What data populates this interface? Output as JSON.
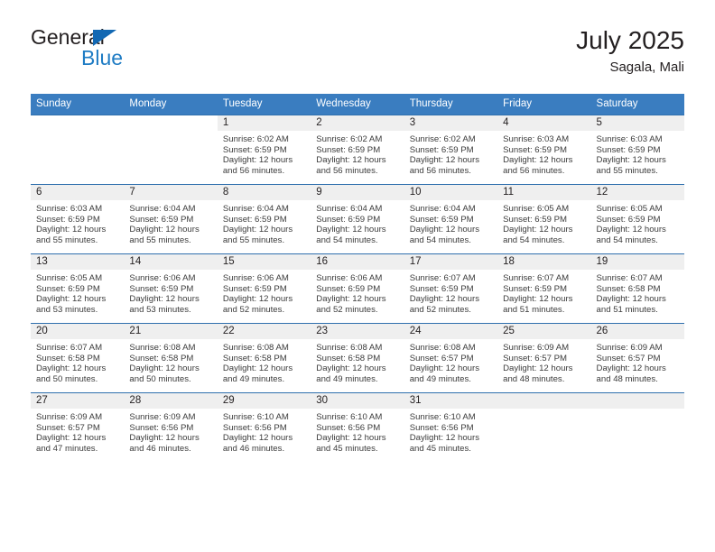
{
  "brand": {
    "name_top": "General",
    "name_bottom": "Blue",
    "accent_color": "#1f7cc4",
    "triangle_color": "#1268b3"
  },
  "header": {
    "title": "July 2025",
    "subtitle": "Sagala, Mali",
    "header_bg": "#3a7dc0",
    "band_bg": "#efefef",
    "rule_color": "#2f6fad"
  },
  "weekdays": [
    "Sunday",
    "Monday",
    "Tuesday",
    "Wednesday",
    "Thursday",
    "Friday",
    "Saturday"
  ],
  "weeks": [
    [
      {
        "day": "",
        "blank": true,
        "sunrise": "",
        "sunset": "",
        "daylight1": "",
        "daylight2": ""
      },
      {
        "day": "",
        "blank": true,
        "sunrise": "",
        "sunset": "",
        "daylight1": "",
        "daylight2": ""
      },
      {
        "day": "1",
        "blank": false,
        "sunrise": "Sunrise: 6:02 AM",
        "sunset": "Sunset: 6:59 PM",
        "daylight1": "Daylight: 12 hours",
        "daylight2": "and 56 minutes."
      },
      {
        "day": "2",
        "blank": false,
        "sunrise": "Sunrise: 6:02 AM",
        "sunset": "Sunset: 6:59 PM",
        "daylight1": "Daylight: 12 hours",
        "daylight2": "and 56 minutes."
      },
      {
        "day": "3",
        "blank": false,
        "sunrise": "Sunrise: 6:02 AM",
        "sunset": "Sunset: 6:59 PM",
        "daylight1": "Daylight: 12 hours",
        "daylight2": "and 56 minutes."
      },
      {
        "day": "4",
        "blank": false,
        "sunrise": "Sunrise: 6:03 AM",
        "sunset": "Sunset: 6:59 PM",
        "daylight1": "Daylight: 12 hours",
        "daylight2": "and 56 minutes."
      },
      {
        "day": "5",
        "blank": false,
        "sunrise": "Sunrise: 6:03 AM",
        "sunset": "Sunset: 6:59 PM",
        "daylight1": "Daylight: 12 hours",
        "daylight2": "and 55 minutes."
      }
    ],
    [
      {
        "day": "6",
        "blank": false,
        "sunrise": "Sunrise: 6:03 AM",
        "sunset": "Sunset: 6:59 PM",
        "daylight1": "Daylight: 12 hours",
        "daylight2": "and 55 minutes."
      },
      {
        "day": "7",
        "blank": false,
        "sunrise": "Sunrise: 6:04 AM",
        "sunset": "Sunset: 6:59 PM",
        "daylight1": "Daylight: 12 hours",
        "daylight2": "and 55 minutes."
      },
      {
        "day": "8",
        "blank": false,
        "sunrise": "Sunrise: 6:04 AM",
        "sunset": "Sunset: 6:59 PM",
        "daylight1": "Daylight: 12 hours",
        "daylight2": "and 55 minutes."
      },
      {
        "day": "9",
        "blank": false,
        "sunrise": "Sunrise: 6:04 AM",
        "sunset": "Sunset: 6:59 PM",
        "daylight1": "Daylight: 12 hours",
        "daylight2": "and 54 minutes."
      },
      {
        "day": "10",
        "blank": false,
        "sunrise": "Sunrise: 6:04 AM",
        "sunset": "Sunset: 6:59 PM",
        "daylight1": "Daylight: 12 hours",
        "daylight2": "and 54 minutes."
      },
      {
        "day": "11",
        "blank": false,
        "sunrise": "Sunrise: 6:05 AM",
        "sunset": "Sunset: 6:59 PM",
        "daylight1": "Daylight: 12 hours",
        "daylight2": "and 54 minutes."
      },
      {
        "day": "12",
        "blank": false,
        "sunrise": "Sunrise: 6:05 AM",
        "sunset": "Sunset: 6:59 PM",
        "daylight1": "Daylight: 12 hours",
        "daylight2": "and 54 minutes."
      }
    ],
    [
      {
        "day": "13",
        "blank": false,
        "sunrise": "Sunrise: 6:05 AM",
        "sunset": "Sunset: 6:59 PM",
        "daylight1": "Daylight: 12 hours",
        "daylight2": "and 53 minutes."
      },
      {
        "day": "14",
        "blank": false,
        "sunrise": "Sunrise: 6:06 AM",
        "sunset": "Sunset: 6:59 PM",
        "daylight1": "Daylight: 12 hours",
        "daylight2": "and 53 minutes."
      },
      {
        "day": "15",
        "blank": false,
        "sunrise": "Sunrise: 6:06 AM",
        "sunset": "Sunset: 6:59 PM",
        "daylight1": "Daylight: 12 hours",
        "daylight2": "and 52 minutes."
      },
      {
        "day": "16",
        "blank": false,
        "sunrise": "Sunrise: 6:06 AM",
        "sunset": "Sunset: 6:59 PM",
        "daylight1": "Daylight: 12 hours",
        "daylight2": "and 52 minutes."
      },
      {
        "day": "17",
        "blank": false,
        "sunrise": "Sunrise: 6:07 AM",
        "sunset": "Sunset: 6:59 PM",
        "daylight1": "Daylight: 12 hours",
        "daylight2": "and 52 minutes."
      },
      {
        "day": "18",
        "blank": false,
        "sunrise": "Sunrise: 6:07 AM",
        "sunset": "Sunset: 6:59 PM",
        "daylight1": "Daylight: 12 hours",
        "daylight2": "and 51 minutes."
      },
      {
        "day": "19",
        "blank": false,
        "sunrise": "Sunrise: 6:07 AM",
        "sunset": "Sunset: 6:58 PM",
        "daylight1": "Daylight: 12 hours",
        "daylight2": "and 51 minutes."
      }
    ],
    [
      {
        "day": "20",
        "blank": false,
        "sunrise": "Sunrise: 6:07 AM",
        "sunset": "Sunset: 6:58 PM",
        "daylight1": "Daylight: 12 hours",
        "daylight2": "and 50 minutes."
      },
      {
        "day": "21",
        "blank": false,
        "sunrise": "Sunrise: 6:08 AM",
        "sunset": "Sunset: 6:58 PM",
        "daylight1": "Daylight: 12 hours",
        "daylight2": "and 50 minutes."
      },
      {
        "day": "22",
        "blank": false,
        "sunrise": "Sunrise: 6:08 AM",
        "sunset": "Sunset: 6:58 PM",
        "daylight1": "Daylight: 12 hours",
        "daylight2": "and 49 minutes."
      },
      {
        "day": "23",
        "blank": false,
        "sunrise": "Sunrise: 6:08 AM",
        "sunset": "Sunset: 6:58 PM",
        "daylight1": "Daylight: 12 hours",
        "daylight2": "and 49 minutes."
      },
      {
        "day": "24",
        "blank": false,
        "sunrise": "Sunrise: 6:08 AM",
        "sunset": "Sunset: 6:57 PM",
        "daylight1": "Daylight: 12 hours",
        "daylight2": "and 49 minutes."
      },
      {
        "day": "25",
        "blank": false,
        "sunrise": "Sunrise: 6:09 AM",
        "sunset": "Sunset: 6:57 PM",
        "daylight1": "Daylight: 12 hours",
        "daylight2": "and 48 minutes."
      },
      {
        "day": "26",
        "blank": false,
        "sunrise": "Sunrise: 6:09 AM",
        "sunset": "Sunset: 6:57 PM",
        "daylight1": "Daylight: 12 hours",
        "daylight2": "and 48 minutes."
      }
    ],
    [
      {
        "day": "27",
        "blank": false,
        "sunrise": "Sunrise: 6:09 AM",
        "sunset": "Sunset: 6:57 PM",
        "daylight1": "Daylight: 12 hours",
        "daylight2": "and 47 minutes."
      },
      {
        "day": "28",
        "blank": false,
        "sunrise": "Sunrise: 6:09 AM",
        "sunset": "Sunset: 6:56 PM",
        "daylight1": "Daylight: 12 hours",
        "daylight2": "and 46 minutes."
      },
      {
        "day": "29",
        "blank": false,
        "sunrise": "Sunrise: 6:10 AM",
        "sunset": "Sunset: 6:56 PM",
        "daylight1": "Daylight: 12 hours",
        "daylight2": "and 46 minutes."
      },
      {
        "day": "30",
        "blank": false,
        "sunrise": "Sunrise: 6:10 AM",
        "sunset": "Sunset: 6:56 PM",
        "daylight1": "Daylight: 12 hours",
        "daylight2": "and 45 minutes."
      },
      {
        "day": "31",
        "blank": false,
        "sunrise": "Sunrise: 6:10 AM",
        "sunset": "Sunset: 6:56 PM",
        "daylight1": "Daylight: 12 hours",
        "daylight2": "and 45 minutes."
      },
      {
        "day": "",
        "blank": true,
        "sunrise": "",
        "sunset": "",
        "daylight1": "",
        "daylight2": ""
      },
      {
        "day": "",
        "blank": true,
        "sunrise": "",
        "sunset": "",
        "daylight1": "",
        "daylight2": ""
      }
    ]
  ]
}
